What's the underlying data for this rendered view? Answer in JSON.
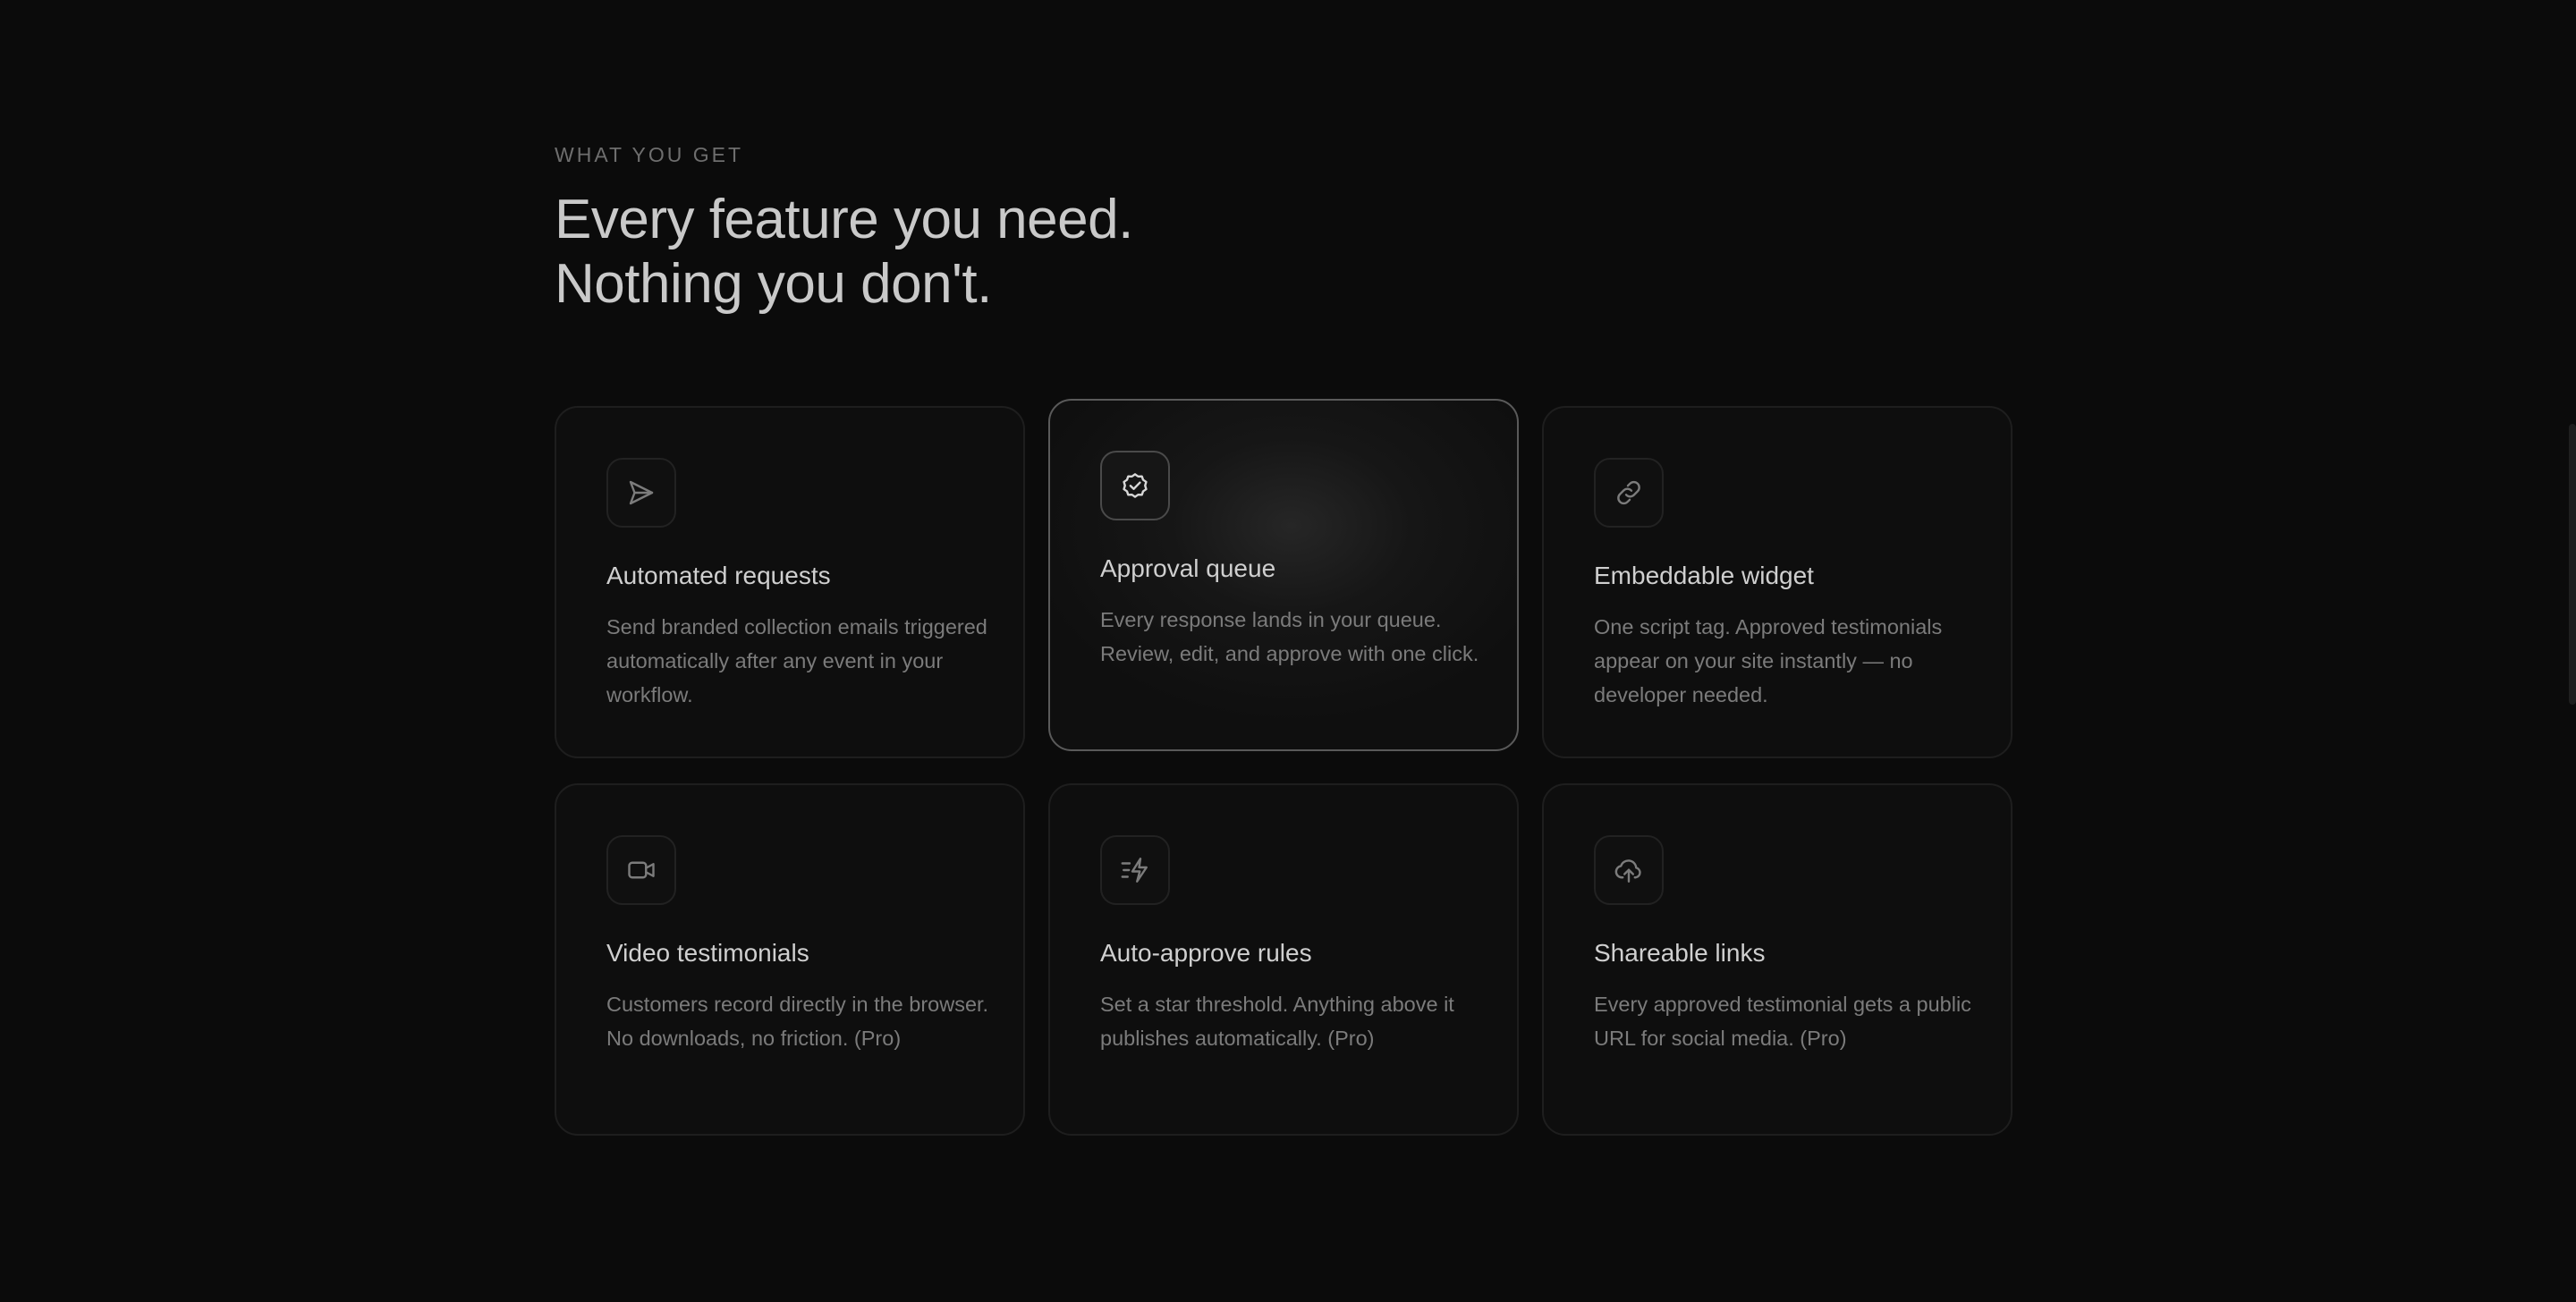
{
  "section": {
    "eyebrow": "WHAT YOU GET",
    "headline_line1": "Every feature you need.",
    "headline_line2": "Nothing you don't."
  },
  "features": [
    {
      "icon": "send-icon",
      "title": "Automated requests",
      "description": "Send branded collection emails triggered automatically after any event in your workflow."
    },
    {
      "icon": "badge-check-icon",
      "title": "Approval queue",
      "description": "Every response lands in your queue. Review, edit, and approve with one click."
    },
    {
      "icon": "link-icon",
      "title": "Embeddable widget",
      "description": "One script tag. Approved testimonials appear on your site instantly — no developer needed."
    },
    {
      "icon": "video-icon",
      "title": "Video testimonials",
      "description": "Customers record directly in the browser. No downloads, no friction. (Pro)"
    },
    {
      "icon": "zap-fast-icon",
      "title": "Auto-approve rules",
      "description": "Set a star threshold. Anything above it publishes automatically. (Pro)"
    },
    {
      "icon": "cloud-upload-icon",
      "title": "Shareable links",
      "description": "Every approved testimonial gets a public URL for social media. (Pro)"
    }
  ],
  "colors": {
    "background": "#0b0b0b",
    "card_border": "#1e1e1e",
    "active_card_border": "#5a5a5a",
    "headline": "#c9c9c9",
    "body_text": "#7b7b7b"
  }
}
